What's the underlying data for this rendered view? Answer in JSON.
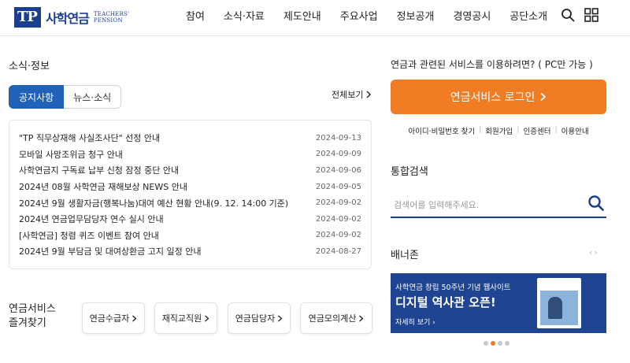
{
  "header": {
    "logo_mark": "TP",
    "logo_ko": "사학연금",
    "logo_en_line1": "TEACHERS'",
    "logo_en_line2": "PENSION",
    "nav": [
      "참여",
      "소식·자료",
      "제도안내",
      "주요사업",
      "정보공개",
      "경영공시",
      "공단소개"
    ],
    "icons": [
      "search-icon",
      "menu-grid-icon"
    ]
  },
  "news": {
    "title": "소식·정보",
    "tab_active": "공지사항",
    "tab_inactive": "뉴스·소식",
    "more": "전체보기",
    "items": [
      {
        "title": "\"TP 직무상재해 사실조사단\" 선정 안내",
        "date": "2024-09-13"
      },
      {
        "title": "모바일 사망조위금 청구 안내",
        "date": "2024-09-09"
      },
      {
        "title": "사학연금지 구독료 납부 신청 잠정 중단 안내",
        "date": "2024-09-06"
      },
      {
        "title": "2024년 08월 사학연금 재해보상 NEWS 안내",
        "date": "2024-09-05"
      },
      {
        "title": "2024년 9월 생활자금(행복나눔)대여 예산 현황 안내(9. 12. 14:00 기준)",
        "date": "2024-09-02"
      },
      {
        "title": "2024년 연금업무담당자 연수 실시 안내",
        "date": "2024-09-02"
      },
      {
        "title": "[사학연금] 청렴 퀴즈 이벤트 참여 안내",
        "date": "2024-09-02"
      },
      {
        "title": "2024년 9월 부담금 및 대여상환금 고지 일정 안내",
        "date": "2024-08-27"
      }
    ]
  },
  "favorites": {
    "label_line1": "연금서비스",
    "label_line2": "즐겨찾기",
    "buttons": [
      "연금수급자",
      "재직교직원",
      "연금담당자",
      "연금모의계산"
    ]
  },
  "login": {
    "caption": "연금과 관련된 서비스를 이용하려면? ( PC만 가능 )",
    "button": "연금서비스 로그인",
    "links": [
      "아이디·비밀번호 찾기",
      "회원가입",
      "인증센터",
      "이용안내"
    ]
  },
  "search": {
    "title": "통합검색",
    "placeholder": "검색어를 입력해주세요."
  },
  "banner": {
    "title": "배너존",
    "sub": "사학연금 창립 50주년 기념 웹사이트",
    "main": "디지털 역사관 오픈!",
    "more": "자세히 보기",
    "slide_count": 4,
    "active_slide": 2
  },
  "colors": {
    "primary_blue": "#1f62b8",
    "navy": "#1b3e8f",
    "orange": "#f07c24",
    "banner_bg": "#1f4592"
  }
}
